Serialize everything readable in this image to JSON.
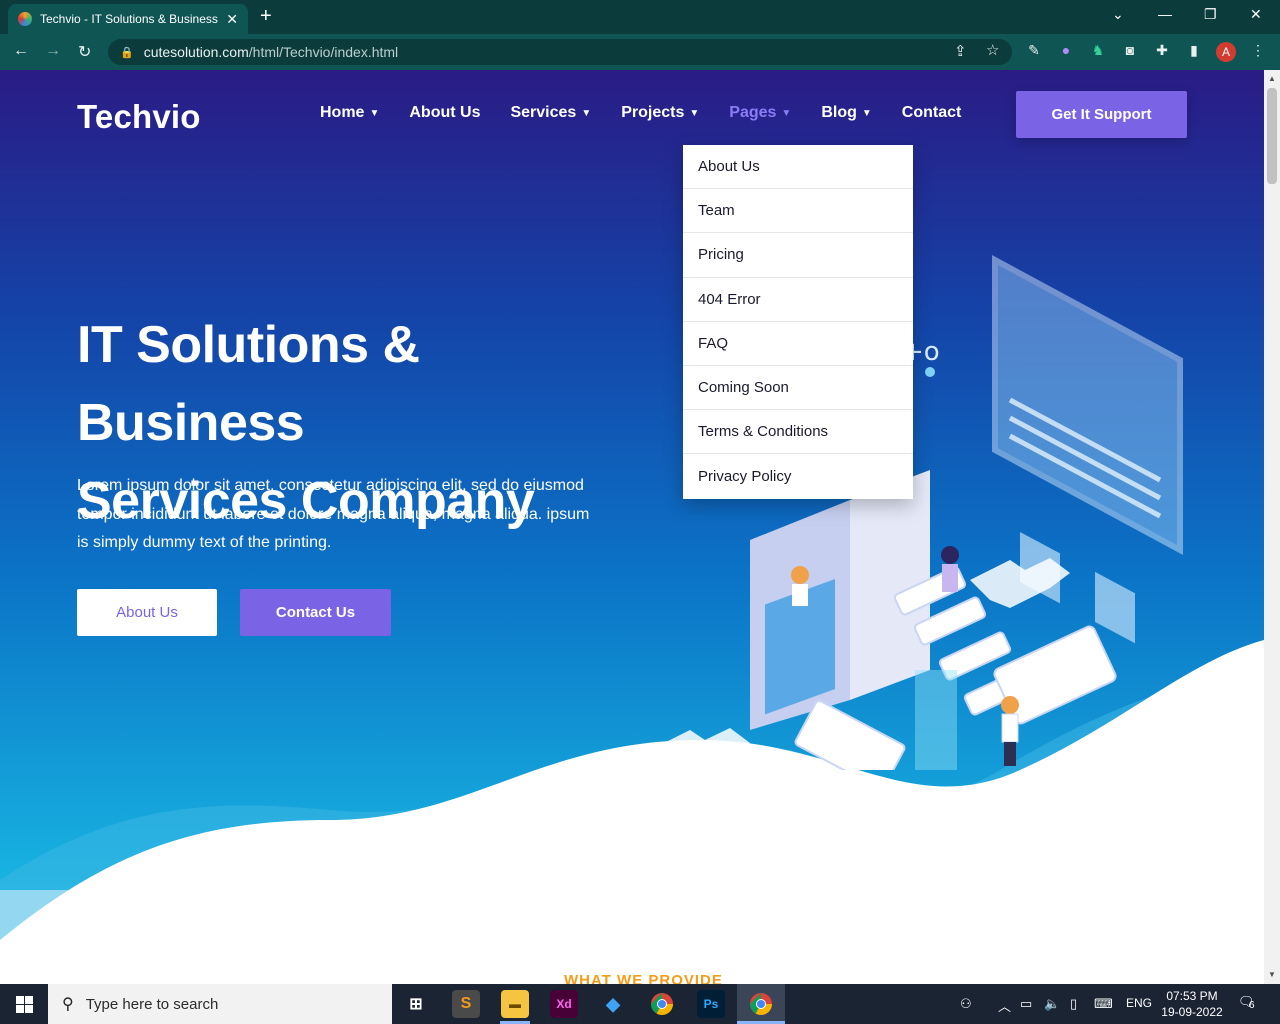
{
  "browser": {
    "tab_title": "Techvio - IT Solutions & Business",
    "url_host": "cutesolution.com",
    "url_path": "/html/Techvio/index.html",
    "profile_initial": "A"
  },
  "site": {
    "logo": "Techvio",
    "nav": [
      {
        "label": "Home",
        "has_dropdown": true
      },
      {
        "label": "About Us",
        "has_dropdown": false
      },
      {
        "label": "Services",
        "has_dropdown": true
      },
      {
        "label": "Projects",
        "has_dropdown": true
      },
      {
        "label": "Pages",
        "has_dropdown": true,
        "active": true
      },
      {
        "label": "Blog",
        "has_dropdown": true
      },
      {
        "label": "Contact",
        "has_dropdown": false
      }
    ],
    "support_button": "Get It Support",
    "pages_dropdown": [
      "About Us",
      "Team",
      "Pricing",
      "404 Error",
      "FAQ",
      "Coming Soon",
      "Terms & Conditions",
      "Privacy Policy"
    ],
    "hero": {
      "title_line1": "IT Solutions & Business",
      "title_line2": "Services Company",
      "text": "Lorem ipsum dolor sit amet, consectetur adipiscing elit, sed do eiusmod tempor incididunt ut labore et dolore magna aliqua, magna aliqua. ipsum is simply dummy text of the printing.",
      "btn_about": "About Us",
      "btn_contact": "Contact Us"
    },
    "section_label": "WHAT WE PROVIDE"
  },
  "taskbar": {
    "search_placeholder": "Type here to search",
    "language": "ENG",
    "time": "07:53 PM",
    "date": "19-09-2022",
    "notification_count": "6"
  },
  "colors": {
    "accent": "#7b63e6",
    "hero_top": "#2a1b85",
    "hero_bottom": "#18b5e2",
    "section_label": "#f59c1a"
  }
}
